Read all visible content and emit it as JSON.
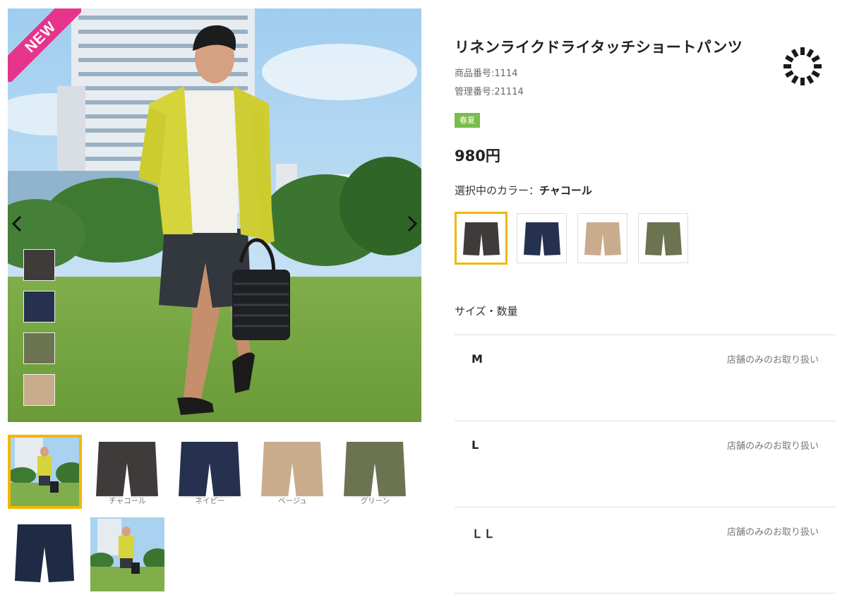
{
  "product": {
    "title": "リネンライクドライタッチショートパンツ",
    "item_number": "商品番号:1114",
    "management_number": "管理番号:21114",
    "season_badge": "春夏",
    "price": "980円",
    "color_label": "選択中のカラー：",
    "selected_color": "チャコール"
  },
  "badge": {
    "new": "NEW"
  },
  "colors": [
    {
      "name": "チャコール",
      "hex": "#3e3b3a"
    },
    {
      "name": "ネイビー",
      "hex": "#263150"
    },
    {
      "name": "ベージュ",
      "hex": "#c8ac8c"
    },
    {
      "name": "グリーン",
      "hex": "#6b7350"
    }
  ],
  "thumbnails": {
    "captions": [
      "チャコール",
      "ネイビー",
      "ベージュ",
      "グリーン"
    ]
  },
  "sizes": {
    "heading": "サイズ・数量",
    "rows": [
      {
        "size": "M",
        "availability": "店舗のみのお取り扱い"
      },
      {
        "size": "L",
        "availability": "店舗のみのお取り扱い"
      },
      {
        "size": "ＬＬ",
        "availability": "店舗のみのお取り扱い"
      }
    ]
  },
  "palette": {
    "accent_yellow": "#f2b705",
    "badge_pink": "#e6348a",
    "season_green": "#7cbc4a"
  }
}
